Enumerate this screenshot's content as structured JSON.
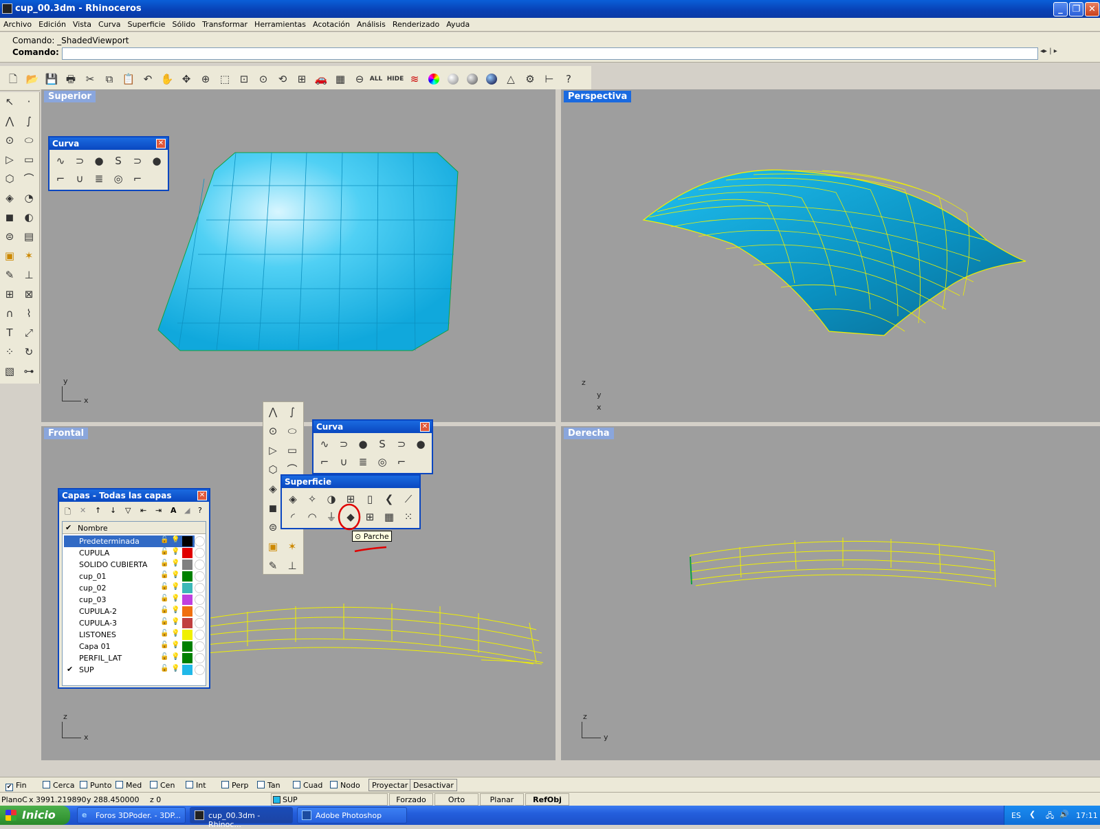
{
  "window": {
    "title": "cup_00.3dm - Rhinoceros"
  },
  "menu": [
    "Archivo",
    "Edición",
    "Vista",
    "Curva",
    "Superficie",
    "Sólido",
    "Transformar",
    "Herramientas",
    "Acotación",
    "Análisis",
    "Renderizado",
    "Ayuda"
  ],
  "command": {
    "history": "Comando: _ShadedViewport",
    "prompt": "Comando:"
  },
  "toolbar": {
    "all_label": "ALL",
    "hide_label": "HIDE"
  },
  "viewports": {
    "top": {
      "label": "Superior",
      "axis1": "y",
      "axis2": "x"
    },
    "perspective": {
      "label": "Perspectiva",
      "axis1": "z",
      "axis2": "y",
      "axis3": "x"
    },
    "front": {
      "label": "Frontal",
      "axis1": "z",
      "axis2": "x"
    },
    "right": {
      "label": "Derecha",
      "axis1": "z",
      "axis2": "y"
    }
  },
  "panels": {
    "curva1": {
      "title": "Curva"
    },
    "curva2": {
      "title": "Curva"
    },
    "superficie": {
      "title": "Superficie"
    },
    "tooltip": "Parche"
  },
  "layers": {
    "title": "Capas - Todas las capas",
    "header": "Nombre",
    "rows": [
      {
        "name": "Predeterminada",
        "color": "#000000"
      },
      {
        "name": "CUPULA",
        "color": "#e00000"
      },
      {
        "name": "SOLIDO CUBIERTA",
        "color": "#808080"
      },
      {
        "name": "cup_01",
        "color": "#008000"
      },
      {
        "name": "cup_02",
        "color": "#3cb8b8"
      },
      {
        "name": "cup_03",
        "color": "#c040e0"
      },
      {
        "name": "CUPULA-2",
        "color": "#f07010"
      },
      {
        "name": "CUPULA-3",
        "color": "#c04040"
      },
      {
        "name": "LISTONES",
        "color": "#f0f000"
      },
      {
        "name": "Capa 01",
        "color": "#008000"
      },
      {
        "name": "PERFIL_LAT",
        "color": "#008000"
      },
      {
        "name": "SUP",
        "color": "#20b8e8"
      }
    ],
    "current": "SUP"
  },
  "osnaps": [
    {
      "label": "Fin",
      "checked": true
    },
    {
      "label": "Cerca",
      "checked": false
    },
    {
      "label": "Punto",
      "checked": false
    },
    {
      "label": "Med",
      "checked": false
    },
    {
      "label": "Cen",
      "checked": false
    },
    {
      "label": "Int",
      "checked": false
    },
    {
      "label": "Perp",
      "checked": false
    },
    {
      "label": "Tan",
      "checked": false
    },
    {
      "label": "Cuad",
      "checked": false
    },
    {
      "label": "Nodo",
      "checked": false
    }
  ],
  "osnap_buttons": {
    "project": "Proyectar",
    "disable": "Desactivar"
  },
  "status": {
    "cplane": "PlanoC",
    "x": "x 3991.219890",
    "y": "y 288.450000",
    "z": "z 0",
    "layer": "SUP",
    "snap": "Forzado",
    "ortho": "Orto",
    "planar": "Planar",
    "osnap": "RefObj"
  },
  "taskbar": {
    "start": "Inicio",
    "tasks": [
      "Foros 3DPoder. - 3DP...",
      "cup_00.3dm - Rhinoc...",
      "Adobe Photoshop"
    ],
    "lang": "ES",
    "clock": "17:11"
  },
  "colors": {
    "surface": "#20b8e8",
    "wire": "#f0f000",
    "viewport_bg": "#9e9e9e",
    "annotation": "#e00000"
  }
}
